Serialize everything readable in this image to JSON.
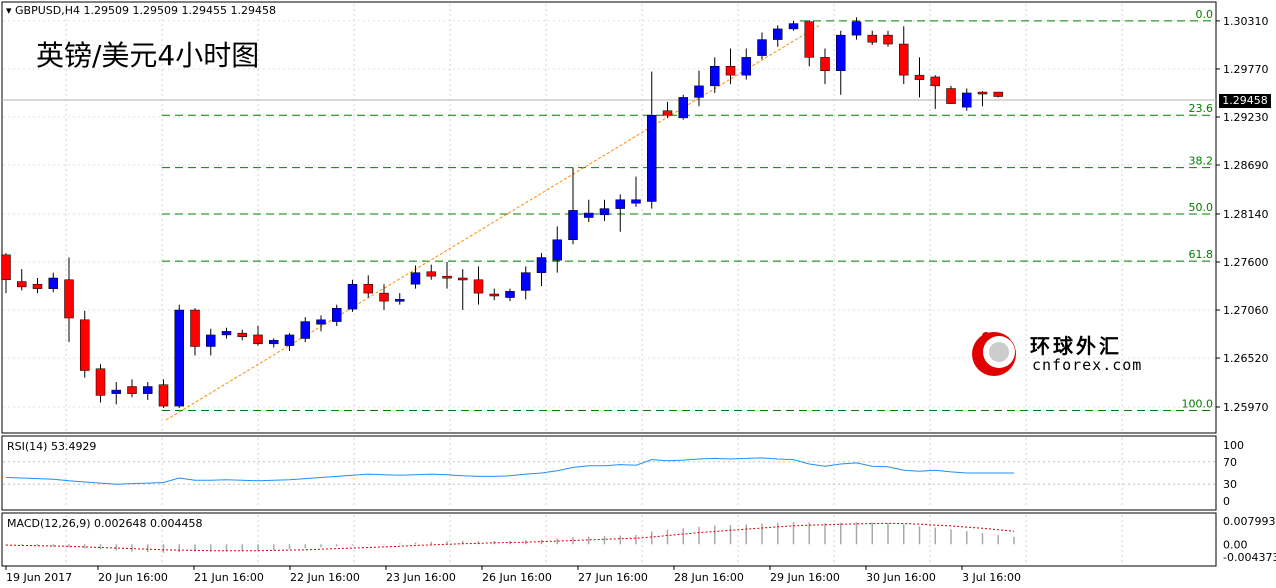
{
  "header": {
    "symbol_line": "GBPUSD,H4  1.29509 1.29509 1.29455 1.29458",
    "title": "英镑/美元4小时图"
  },
  "current_price": "1.29458",
  "watermark": {
    "cn": "环球外汇",
    "en": "cnforex.com"
  },
  "colors": {
    "bull": "#0000ff",
    "bear": "#ff0000",
    "fib": "#008000",
    "rsi": "#1e90ff",
    "macd_signal": "#cc0000",
    "trend": "#ff8c00"
  },
  "chart_data": [
    {
      "type": "candlestick",
      "ylim": [
        1.257,
        1.305
      ],
      "y_ticks": [
        "1.30310",
        "1.29770",
        "1.29230",
        "1.28690",
        "1.28140",
        "1.27600",
        "1.27060",
        "1.26520",
        "1.25970"
      ],
      "x_ticks": [
        "19 Jun 2017",
        "20 Jun 16:00",
        "21 Jun 16:00",
        "22 Jun 16:00",
        "23 Jun 16:00",
        "26 Jun 16:00",
        "27 Jun 16:00",
        "28 Jun 16:00",
        "29 Jun 16:00",
        "30 Jun 16:00",
        "3 Jul 16:00"
      ],
      "fib_levels": [
        {
          "label": "0.0",
          "price": 1.3031
        },
        {
          "label": "23.6",
          "price": 1.2925
        },
        {
          "label": "38.2",
          "price": 1.2866
        },
        {
          "label": "50.0",
          "price": 1.2814
        },
        {
          "label": "61.8",
          "price": 1.2761
        },
        {
          "label": "100.0",
          "price": 1.2593
        }
      ],
      "candles": [
        {
          "o": 1.2768,
          "h": 1.277,
          "l": 1.2725,
          "c": 1.274
        },
        {
          "o": 1.2738,
          "h": 1.2752,
          "l": 1.2728,
          "c": 1.2732
        },
        {
          "o": 1.2735,
          "h": 1.2742,
          "l": 1.2725,
          "c": 1.273
        },
        {
          "o": 1.273,
          "h": 1.2748,
          "l": 1.2726,
          "c": 1.2742
        },
        {
          "o": 1.274,
          "h": 1.2765,
          "l": 1.267,
          "c": 1.2697
        },
        {
          "o": 1.2695,
          "h": 1.2705,
          "l": 1.263,
          "c": 1.2638
        },
        {
          "o": 1.264,
          "h": 1.2645,
          "l": 1.2602,
          "c": 1.261
        },
        {
          "o": 1.2612,
          "h": 1.2625,
          "l": 1.26,
          "c": 1.2616
        },
        {
          "o": 1.262,
          "h": 1.2628,
          "l": 1.2608,
          "c": 1.2612
        },
        {
          "o": 1.2612,
          "h": 1.2625,
          "l": 1.2605,
          "c": 1.262
        },
        {
          "o": 1.2622,
          "h": 1.2628,
          "l": 1.2596,
          "c": 1.2598
        },
        {
          "o": 1.2598,
          "h": 1.2712,
          "l": 1.2596,
          "c": 1.2706
        },
        {
          "o": 1.2706,
          "h": 1.2708,
          "l": 1.2655,
          "c": 1.2665
        },
        {
          "o": 1.2665,
          "h": 1.2685,
          "l": 1.2655,
          "c": 1.2678
        },
        {
          "o": 1.2678,
          "h": 1.2686,
          "l": 1.2674,
          "c": 1.2682
        },
        {
          "o": 1.268,
          "h": 1.2684,
          "l": 1.2672,
          "c": 1.2676
        },
        {
          "o": 1.2678,
          "h": 1.2688,
          "l": 1.2666,
          "c": 1.2668
        },
        {
          "o": 1.2668,
          "h": 1.2674,
          "l": 1.2664,
          "c": 1.2672
        },
        {
          "o": 1.2666,
          "h": 1.268,
          "l": 1.266,
          "c": 1.2678
        },
        {
          "o": 1.2674,
          "h": 1.2698,
          "l": 1.267,
          "c": 1.2693
        },
        {
          "o": 1.269,
          "h": 1.27,
          "l": 1.2682,
          "c": 1.2695
        },
        {
          "o": 1.2693,
          "h": 1.2712,
          "l": 1.2688,
          "c": 1.2708
        },
        {
          "o": 1.2707,
          "h": 1.274,
          "l": 1.2704,
          "c": 1.2735
        },
        {
          "o": 1.2735,
          "h": 1.2745,
          "l": 1.272,
          "c": 1.2725
        },
        {
          "o": 1.2725,
          "h": 1.2735,
          "l": 1.2706,
          "c": 1.2716
        },
        {
          "o": 1.2716,
          "h": 1.2725,
          "l": 1.2712,
          "c": 1.2718
        },
        {
          "o": 1.2735,
          "h": 1.2756,
          "l": 1.273,
          "c": 1.2748
        },
        {
          "o": 1.2749,
          "h": 1.2757,
          "l": 1.274,
          "c": 1.2744
        },
        {
          "o": 1.2744,
          "h": 1.276,
          "l": 1.273,
          "c": 1.2742
        },
        {
          "o": 1.2742,
          "h": 1.2752,
          "l": 1.2706,
          "c": 1.274
        },
        {
          "o": 1.274,
          "h": 1.2755,
          "l": 1.2712,
          "c": 1.2725
        },
        {
          "o": 1.2724,
          "h": 1.273,
          "l": 1.2717,
          "c": 1.2722
        },
        {
          "o": 1.272,
          "h": 1.273,
          "l": 1.2716,
          "c": 1.2727
        },
        {
          "o": 1.2728,
          "h": 1.2755,
          "l": 1.2718,
          "c": 1.2748
        },
        {
          "o": 1.2748,
          "h": 1.277,
          "l": 1.2733,
          "c": 1.2765
        },
        {
          "o": 1.2762,
          "h": 1.28,
          "l": 1.2748,
          "c": 1.2785
        },
        {
          "o": 1.2785,
          "h": 1.2866,
          "l": 1.278,
          "c": 1.2818
        },
        {
          "o": 1.281,
          "h": 1.283,
          "l": 1.2805,
          "c": 1.2815
        },
        {
          "o": 1.2813,
          "h": 1.283,
          "l": 1.2806,
          "c": 1.282
        },
        {
          "o": 1.282,
          "h": 1.2836,
          "l": 1.2794,
          "c": 1.283
        },
        {
          "o": 1.2826,
          "h": 1.2856,
          "l": 1.2822,
          "c": 1.283
        },
        {
          "o": 1.2828,
          "h": 1.2974,
          "l": 1.282,
          "c": 1.2925
        },
        {
          "o": 1.293,
          "h": 1.294,
          "l": 1.2922,
          "c": 1.2925
        },
        {
          "o": 1.2922,
          "h": 1.2948,
          "l": 1.292,
          "c": 1.2945
        },
        {
          "o": 1.2945,
          "h": 1.2975,
          "l": 1.2935,
          "c": 1.2958
        },
        {
          "o": 1.2958,
          "h": 1.299,
          "l": 1.295,
          "c": 1.298
        },
        {
          "o": 1.298,
          "h": 1.3,
          "l": 1.296,
          "c": 1.297
        },
        {
          "o": 1.297,
          "h": 1.3,
          "l": 1.2965,
          "c": 1.299
        },
        {
          "o": 1.2992,
          "h": 1.3018,
          "l": 1.2988,
          "c": 1.301
        },
        {
          "o": 1.301,
          "h": 1.3026,
          "l": 1.3002,
          "c": 1.3022
        },
        {
          "o": 1.3022,
          "h": 1.3031,
          "l": 1.302,
          "c": 1.3028
        },
        {
          "o": 1.303,
          "h": 1.3032,
          "l": 1.298,
          "c": 1.299
        },
        {
          "o": 1.299,
          "h": 1.3,
          "l": 1.296,
          "c": 1.2975
        },
        {
          "o": 1.2975,
          "h": 1.302,
          "l": 1.2948,
          "c": 1.3015
        },
        {
          "o": 1.3015,
          "h": 1.3035,
          "l": 1.301,
          "c": 1.303
        },
        {
          "o": 1.3015,
          "h": 1.302,
          "l": 1.3004,
          "c": 1.3007
        },
        {
          "o": 1.3015,
          "h": 1.302,
          "l": 1.3002,
          "c": 1.3005
        },
        {
          "o": 1.3005,
          "h": 1.3025,
          "l": 1.296,
          "c": 1.297
        },
        {
          "o": 1.297,
          "h": 1.299,
          "l": 1.2945,
          "c": 1.2965
        },
        {
          "o": 1.2968,
          "h": 1.297,
          "l": 1.2932,
          "c": 1.2958
        },
        {
          "o": 1.2955,
          "h": 1.2958,
          "l": 1.2938,
          "c": 1.2938
        },
        {
          "o": 1.2934,
          "h": 1.2955,
          "l": 1.293,
          "c": 1.295
        },
        {
          "o": 1.2951,
          "h": 1.2952,
          "l": 1.2935,
          "c": 1.2949
        },
        {
          "o": 1.2951,
          "h": 1.2951,
          "l": 1.2945,
          "c": 1.2946
        }
      ]
    },
    {
      "type": "line",
      "title": "RSI(14) 53.4929",
      "ylim": [
        0,
        100
      ],
      "y_ticks": [
        "100",
        "70",
        "30",
        "0"
      ],
      "values": [
        42,
        41,
        40,
        39,
        36,
        34,
        32,
        30,
        31,
        32,
        33,
        41,
        37,
        37,
        38,
        37,
        36,
        37,
        38,
        40,
        42,
        44,
        46,
        48,
        47,
        46,
        47,
        48,
        47,
        45,
        44,
        44,
        45,
        48,
        50,
        54,
        60,
        63,
        63,
        65,
        64,
        74,
        72,
        73,
        75,
        76,
        75,
        76,
        77,
        75,
        74,
        66,
        62,
        66,
        68,
        62,
        61,
        55,
        53,
        55,
        52,
        50,
        50,
        50,
        50
      ]
    },
    {
      "type": "bar",
      "title": "MACD(12,26,9) 0.002648 0.004458",
      "ylim": [
        -0.004373,
        0.007993
      ],
      "y_ticks": [
        "0.007993",
        "0.00",
        "-0.004373"
      ],
      "values": [
        -0.0002,
        -0.0004,
        -0.0006,
        -0.0008,
        -0.0011,
        -0.0014,
        -0.0018,
        -0.0022,
        -0.0025,
        -0.0027,
        -0.0029,
        -0.0026,
        -0.0025,
        -0.0024,
        -0.0023,
        -0.0022,
        -0.0021,
        -0.0019,
        -0.0016,
        -0.0013,
        -0.001,
        -0.0007,
        -0.0004,
        -0.0001,
        0.0001,
        0.0003,
        0.0006,
        0.0008,
        0.001,
        0.0011,
        0.0011,
        0.0011,
        0.0012,
        0.0014,
        0.0016,
        0.002,
        0.0024,
        0.0026,
        0.0028,
        0.003,
        0.0032,
        0.0044,
        0.005,
        0.0055,
        0.006,
        0.0064,
        0.0066,
        0.0068,
        0.0071,
        0.0074,
        0.0076,
        0.0075,
        0.0072,
        0.0074,
        0.0076,
        0.0074,
        0.0072,
        0.0068,
        0.0062,
        0.0057,
        0.0051,
        0.0045,
        0.0038,
        0.0032,
        0.0026
      ],
      "signal": [
        -0.0003,
        -0.0004,
        -0.0005,
        -0.0006,
        -0.0007,
        -0.0009,
        -0.0011,
        -0.0013,
        -0.0015,
        -0.0017,
        -0.0019,
        -0.002,
        -0.0021,
        -0.0022,
        -0.0022,
        -0.0022,
        -0.0022,
        -0.0021,
        -0.002,
        -0.0019,
        -0.0017,
        -0.0015,
        -0.0013,
        -0.0011,
        -0.0009,
        -0.0007,
        -0.0004,
        -0.0002,
        0.0,
        0.0002,
        0.0003,
        0.0005,
        0.0006,
        0.0007,
        0.0009,
        0.0011,
        0.0013,
        0.0015,
        0.0017,
        0.0019,
        0.0021,
        0.0025,
        0.003,
        0.0035,
        0.004,
        0.0044,
        0.0048,
        0.0052,
        0.0056,
        0.006,
        0.0063,
        0.0066,
        0.0067,
        0.0069,
        0.007,
        0.0071,
        0.0072,
        0.0071,
        0.0069,
        0.0066,
        0.0063,
        0.0059,
        0.0055,
        0.005,
        0.0045
      ]
    }
  ]
}
